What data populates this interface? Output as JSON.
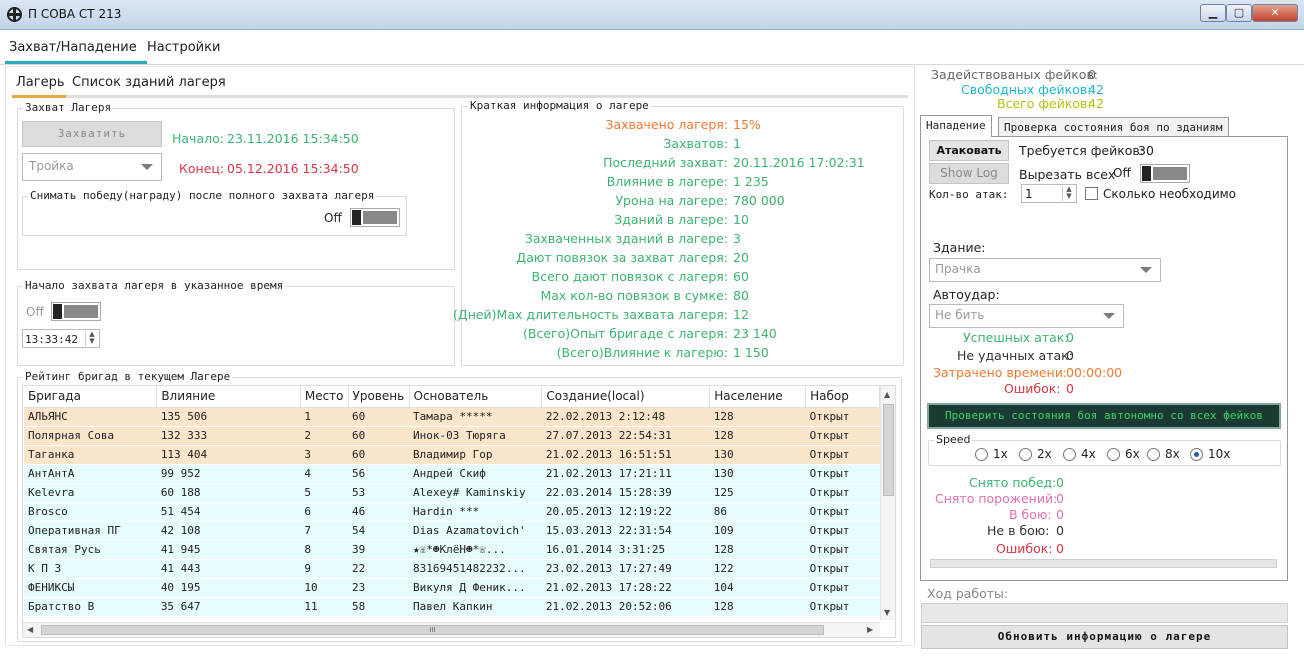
{
  "window": {
    "title": "П СОВА СТ 213",
    "min_label": "▁",
    "max_label": "▢",
    "close_label": "✕"
  },
  "main_tabs": [
    "Захват/Нападение",
    "Настройки"
  ],
  "sub_tabs": [
    "Лагерь",
    "Список зданий лагеря"
  ],
  "capture": {
    "group_title": "Захват Лагеря",
    "capture_button": "Захватить",
    "start_label": "Начало:",
    "start_value": "23.11.2016 15:34:50",
    "end_label": "Конец:",
    "end_value": "05.12.2016 15:34:50",
    "troika_value": "Тройка",
    "remove_victory_title": "Снимать победу(награду) после полного захвата лагеря",
    "remove_victory_state": "Off"
  },
  "scheduled": {
    "group_title": "Начало захвата лагеря в указанное время",
    "toggle_state": "Off",
    "time_value": "13:33:42"
  },
  "info": {
    "group_title": "Краткая информация о лагере",
    "rows": [
      {
        "label": "Захвачено лагеря:",
        "value": "15%",
        "color": "#ee7a30"
      },
      {
        "label": "Захватов:",
        "value": "1",
        "color": "#3cb371"
      },
      {
        "label": "Последний захват:",
        "value": "20.11.2016 17:02:31",
        "color": "#3cb371"
      },
      {
        "label": "Влияние в лагере:",
        "value": "1 235",
        "color": "#3cb371"
      },
      {
        "label": "Урона на лагере:",
        "value": "780 000",
        "color": "#3cb371"
      },
      {
        "label": "Зданий в лагере:",
        "value": "10",
        "color": "#3cb371"
      },
      {
        "label": "Захваченных зданий в лагере:",
        "value": "3",
        "color": "#3cb371"
      },
      {
        "label": "Дают повязок за захват лагеря:",
        "value": "20",
        "color": "#3cb371"
      },
      {
        "label": "Всего дают повязок с лагеря:",
        "value": "60",
        "color": "#3cb371"
      },
      {
        "label": "Мах кол-во повязок в сумке:",
        "value": "80",
        "color": "#3cb371"
      },
      {
        "label": "(Дней)Мах длительность захвата лагеря:",
        "value": "12",
        "color": "#3cb371"
      },
      {
        "label": "(Всего)Опыт бригаде с лагеря:",
        "value": "23 140",
        "color": "#3cb371"
      },
      {
        "label": "(Всего)Влияние  к лагерю:",
        "value": "1 150",
        "color": "#3cb371"
      }
    ]
  },
  "rating": {
    "group_title": "Рейтинг бригад в текущем Лагере",
    "columns": [
      "Бригада",
      "Влияние",
      "Место",
      "Уровень",
      "Основатель",
      "Создание(local)",
      "Население",
      "Набор"
    ],
    "rows": [
      [
        "АЛЬЯНС",
        "135 506",
        "1",
        "60",
        "Тамара *****",
        "22.02.2013 2:12:48",
        "128",
        "Открыт"
      ],
      [
        "Полярная Сова",
        "132 333",
        "2",
        "60",
        "Инок-03 Тюряга",
        "27.07.2013 22:54:31",
        "128",
        "Открыт"
      ],
      [
        "Таганка",
        "113 404",
        "3",
        "60",
        "Владимир Гор",
        "21.02.2013 16:51:51",
        "130",
        "Открыт"
      ],
      [
        "АнтАнтА",
        "99 952",
        "4",
        "56",
        "Андрей Скиф",
        "21.02.2013 17:21:11",
        "130",
        "Открыт"
      ],
      [
        "Kelevra",
        "60 188",
        "5",
        "53",
        "Alexey# Kaminskiy",
        "22.03.2014 15:28:39",
        "125",
        "Открыт"
      ],
      [
        "Brosco",
        "51 454",
        "6",
        "46",
        "Hardin ***",
        "20.05.2013 12:19:22",
        "86",
        "Открыт"
      ],
      [
        "Оперативная  ПГ",
        "42 108",
        "7",
        "54",
        "Dias Azamatovich'",
        "15.03.2013 22:31:54",
        "109",
        "Открыт"
      ],
      [
        "Святая Русь",
        "41 945",
        "8",
        "39",
        "★☏*☻КлёН☻*☏...",
        "16.01.2014 3:31:25",
        "128",
        "Открыт"
      ],
      [
        "К П З",
        "41 443",
        "9",
        "22",
        "83169451482232...",
        "23.02.2013 17:27:49",
        "122",
        "Открыт"
      ],
      [
        "ФЕНИКСЫ",
        "40 195",
        "10",
        "23",
        "Викуля Д Феник...",
        "21.02.2013 17:28:22",
        "104",
        "Открыт"
      ],
      [
        "Братство В",
        "35 647",
        "11",
        "58",
        "Павел Капкин",
        "21.02.2013 20:52:06",
        "128",
        "Открыт"
      ]
    ],
    "highlighted_rows": 3,
    "hscroll_thumb": "III"
  },
  "fakes": {
    "used_label": "Задействованых фейков:",
    "used_value": "0",
    "free_label": "Свободных фейков:",
    "free_value": "42",
    "total_label": "Всего фейков:",
    "total_value": "42"
  },
  "right_tabs": [
    "Нападение",
    "Проверка состояния боя по зданиям"
  ],
  "attack": {
    "attack_button": "Атаковать",
    "showlog_button": "Show Log",
    "required_label": "Требуется фейков:",
    "required_value": "30",
    "cut_all_label": "Вырезать всех",
    "cut_all_state": "Off",
    "attacks_count_label": "Кол-во атак:",
    "attacks_count_value": "1",
    "as_needed_label": "Сколько необходимо",
    "building_label": "Здание:",
    "building_value": "Прачка",
    "autohit_label": "Автоудар:",
    "autohit_value": "Не бить",
    "success_label": "Успешных атак:",
    "success_value": "0",
    "fail_label": "Не удачных атак:",
    "fail_value": "0",
    "time_label": "Затрачено времени:",
    "time_value": "00:00:00",
    "errors_label": "Ошибок:",
    "errors_value": "0",
    "check_button": "Проверить состояния боя автономно со всех фейков",
    "speed_title": "Speed",
    "speeds": [
      "1x",
      "2x",
      "4x",
      "6x",
      "8x",
      "10x"
    ],
    "speed_selected": "10x",
    "wins_label": "Снято побед:",
    "wins_value": "0",
    "losses_label": "Снято порожений:",
    "losses_value": "0",
    "inbattle_label": "В бою:",
    "inbattle_value": "0",
    "notbattle_label": "Не в бою:",
    "notbattle_value": "0",
    "errors2_label": "Ошибок:",
    "errors2_value": "0"
  },
  "progress": {
    "label": "Ход работы:"
  },
  "refresh_button": "Обновить информацию о лагере"
}
